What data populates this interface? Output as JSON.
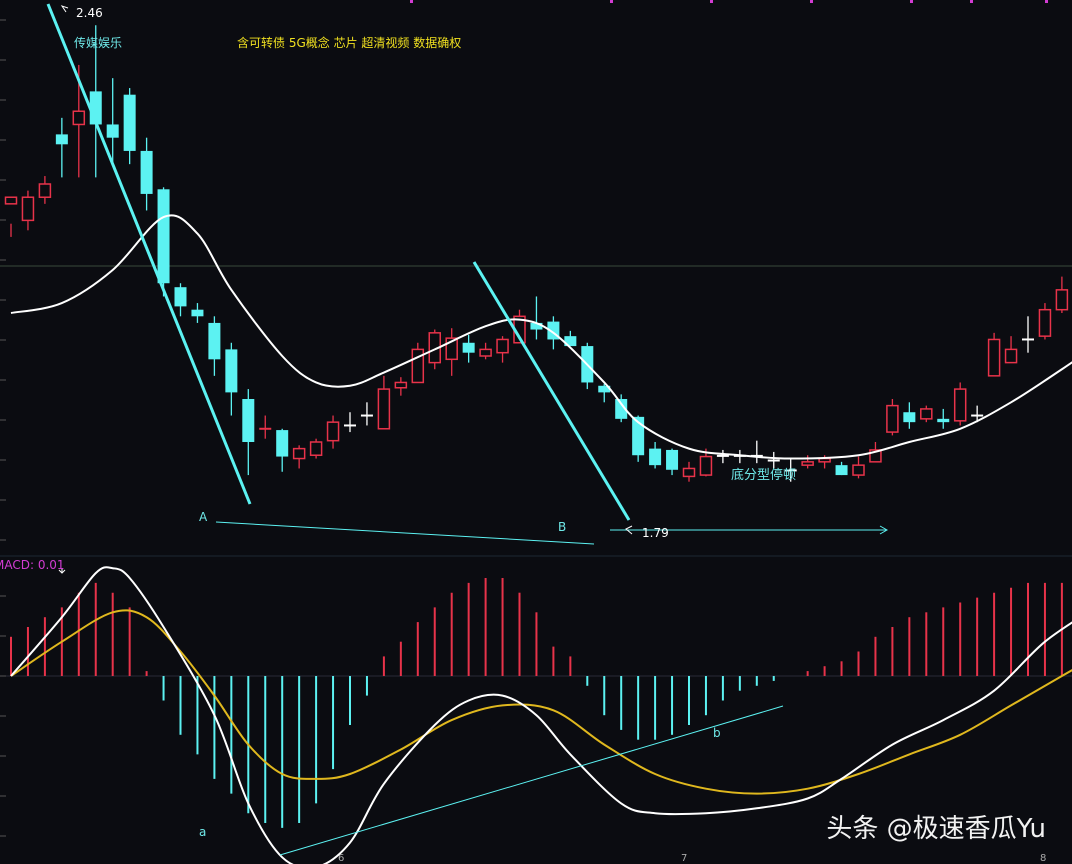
{
  "header": {
    "sector": "传媒娱乐",
    "concepts": "含可转债 5G概念 芯片 超清视频 数据确权"
  },
  "annotations": {
    "high_price": "2.46",
    "low_price": "1.79",
    "point_A": "A",
    "point_B": "B",
    "point_a": "a",
    "point_b": "b",
    "pattern": "底分型停顿"
  },
  "macd_label": "MACD: 0.01",
  "x_ticks": [
    "6",
    "7",
    "8"
  ],
  "watermark": "头条 @极速香瓜Yu",
  "colors": {
    "up": "#e8334a",
    "down": "#5cf2f2",
    "doji": "#ffffff",
    "ma": "#ffffff",
    "dea": "#e0b81e",
    "label_yellow": "#f0e020",
    "label_cyan": "#6fe8e8",
    "macd_label": "#d23cd2"
  },
  "chart_data": {
    "type": "candlestick",
    "price_range": [
      1.7,
      2.48
    ],
    "candles": [
      [
        2.19,
        2.2,
        2.16,
        2.14
      ],
      [
        2.165,
        2.2,
        2.21,
        2.15
      ],
      [
        2.2,
        2.22,
        2.232,
        2.19
      ],
      [
        2.295,
        2.28,
        2.32,
        2.23
      ],
      [
        2.31,
        2.33,
        2.4,
        2.23
      ],
      [
        2.36,
        2.31,
        2.46,
        2.23
      ],
      [
        2.31,
        2.29,
        2.38,
        2.25
      ],
      [
        2.355,
        2.27,
        2.365,
        2.25
      ],
      [
        2.27,
        2.205,
        2.29,
        2.18
      ],
      [
        2.212,
        2.07,
        2.215,
        2.05
      ],
      [
        2.064,
        2.035,
        2.07,
        2.02
      ],
      [
        2.03,
        2.02,
        2.04,
        2.01
      ],
      [
        2.01,
        1.955,
        2.02,
        1.93
      ],
      [
        1.97,
        1.905,
        1.98,
        1.87
      ],
      [
        1.895,
        1.83,
        1.91,
        1.78
      ],
      [
        1.849,
        1.85,
        1.87,
        1.835
      ],
      [
        1.848,
        1.808,
        1.85,
        1.785
      ],
      [
        1.805,
        1.82,
        1.825,
        1.79
      ],
      [
        1.81,
        1.83,
        1.835,
        1.805
      ],
      [
        1.832,
        1.86,
        1.87,
        1.82
      ],
      [
        1.855,
        1.855,
        1.875,
        1.845
      ],
      [
        1.87,
        1.87,
        1.89,
        1.855
      ],
      [
        1.85,
        1.91,
        1.93,
        1.86
      ],
      [
        1.912,
        1.92,
        1.928,
        1.9
      ],
      [
        1.92,
        1.97,
        1.98,
        1.92
      ],
      [
        1.95,
        1.995,
        2.0,
        1.94
      ],
      [
        1.955,
        1.987,
        2.002,
        1.93
      ],
      [
        1.98,
        1.965,
        1.992,
        1.95
      ],
      [
        1.96,
        1.97,
        1.98,
        1.955
      ],
      [
        1.965,
        1.985,
        1.99,
        1.95
      ],
      [
        1.98,
        2.02,
        2.03,
        1.98
      ],
      [
        2.01,
        2.0,
        2.05,
        1.985
      ],
      [
        2.012,
        1.985,
        2.02,
        1.97
      ],
      [
        1.99,
        1.975,
        1.998,
        1.975
      ],
      [
        1.975,
        1.92,
        1.98,
        1.91
      ],
      [
        1.915,
        1.905,
        1.918,
        1.89
      ],
      [
        1.895,
        1.865,
        1.902,
        1.86
      ],
      [
        1.868,
        1.81,
        1.87,
        1.8
      ],
      [
        1.82,
        1.795,
        1.83,
        1.79
      ],
      [
        1.818,
        1.788,
        1.82,
        1.78
      ],
      [
        1.778,
        1.79,
        1.8,
        1.77
      ],
      [
        1.78,
        1.808,
        1.82,
        1.778
      ],
      [
        1.809,
        1.809,
        1.818,
        1.798
      ],
      [
        1.809,
        1.809,
        1.818,
        1.798
      ],
      [
        1.809,
        1.809,
        1.832,
        1.798
      ],
      [
        1.802,
        1.802,
        1.815,
        1.79
      ],
      [
        1.787,
        1.787,
        1.805,
        1.77
      ],
      [
        1.795,
        1.8,
        1.81,
        1.79
      ],
      [
        1.8,
        1.805,
        1.81,
        1.79
      ],
      [
        1.795,
        1.78,
        1.8,
        1.78
      ],
      [
        1.78,
        1.795,
        1.808,
        1.775
      ],
      [
        1.8,
        1.818,
        1.83,
        1.8
      ],
      [
        1.845,
        1.885,
        1.895,
        1.84
      ],
      [
        1.875,
        1.86,
        1.89,
        1.85
      ],
      [
        1.865,
        1.88,
        1.885,
        1.86
      ],
      [
        1.865,
        1.86,
        1.88,
        1.85
      ],
      [
        1.862,
        1.91,
        1.92,
        1.855
      ],
      [
        1.87,
        1.87,
        1.885,
        1.86
      ],
      [
        1.93,
        1.985,
        1.995,
        1.93
      ],
      [
        1.95,
        1.97,
        1.99,
        1.95
      ],
      [
        1.985,
        1.985,
        2.02,
        1.965
      ],
      [
        1.99,
        2.03,
        2.04,
        1.985
      ],
      [
        2.03,
        2.06,
        2.08,
        2.025
      ],
      [
        2.085,
        2.06,
        2.1,
        2.04
      ],
      [
        2.076,
        2.07,
        2.082,
        2.06
      ]
    ],
    "ma": [
      [
        0,
        2.025
      ],
      [
        3,
        2.04
      ],
      [
        6,
        2.09
      ],
      [
        9,
        2.17
      ],
      [
        11,
        2.145
      ],
      [
        13,
        2.06
      ],
      [
        16,
        1.96
      ],
      [
        18,
        1.92
      ],
      [
        20,
        1.915
      ],
      [
        22,
        1.935
      ],
      [
        25,
        1.97
      ],
      [
        28,
        2.005
      ],
      [
        30,
        2.015
      ],
      [
        32,
        1.995
      ],
      [
        35,
        1.92
      ],
      [
        37,
        1.86
      ],
      [
        40,
        1.82
      ],
      [
        43,
        1.81
      ],
      [
        46,
        1.805
      ],
      [
        50,
        1.81
      ],
      [
        53,
        1.83
      ],
      [
        56,
        1.85
      ],
      [
        59,
        1.89
      ],
      [
        62,
        1.94
      ],
      [
        64,
        1.975
      ]
    ],
    "macd_bars": [
      0.08,
      0.1,
      0.12,
      0.14,
      0.17,
      0.19,
      0.17,
      0.14,
      0.01,
      -0.05,
      -0.12,
      -0.16,
      -0.21,
      -0.24,
      -0.28,
      -0.3,
      -0.31,
      -0.3,
      -0.26,
      -0.19,
      -0.1,
      -0.04,
      0.04,
      0.07,
      0.11,
      0.14,
      0.17,
      0.19,
      0.2,
      0.2,
      0.17,
      0.13,
      0.06,
      0.04,
      -0.02,
      -0.08,
      -0.11,
      -0.13,
      -0.13,
      -0.12,
      -0.1,
      -0.08,
      -0.05,
      -0.03,
      -0.02,
      -0.01,
      0.0,
      0.01,
      0.02,
      0.03,
      0.05,
      0.08,
      0.1,
      0.12,
      0.13,
      0.14,
      0.15,
      0.16,
      0.17,
      0.18,
      0.19,
      0.19,
      0.19,
      0.18,
      0.17
    ],
    "dif": [
      [
        0,
        0.0
      ],
      [
        3,
        0.12
      ],
      [
        5,
        0.21
      ],
      [
        6,
        0.22
      ],
      [
        7,
        0.2
      ],
      [
        9,
        0.1
      ],
      [
        12,
        -0.08
      ],
      [
        14,
        -0.26
      ],
      [
        16,
        -0.37
      ],
      [
        18,
        -0.39
      ],
      [
        20,
        -0.34
      ],
      [
        22,
        -0.22
      ],
      [
        25,
        -0.1
      ],
      [
        27,
        -0.05
      ],
      [
        29,
        -0.04
      ],
      [
        31,
        -0.08
      ],
      [
        33,
        -0.16
      ],
      [
        36,
        -0.26
      ],
      [
        38,
        -0.28
      ],
      [
        41,
        -0.28
      ],
      [
        44,
        -0.27
      ],
      [
        47,
        -0.25
      ],
      [
        49,
        -0.21
      ],
      [
        52,
        -0.14
      ],
      [
        55,
        -0.09
      ],
      [
        58,
        -0.03
      ],
      [
        61,
        0.07
      ],
      [
        64,
        0.14
      ]
    ],
    "dea": [
      [
        0,
        0.0
      ],
      [
        3,
        0.07
      ],
      [
        6,
        0.13
      ],
      [
        8,
        0.12
      ],
      [
        10,
        0.05
      ],
      [
        12,
        -0.04
      ],
      [
        14,
        -0.14
      ],
      [
        16,
        -0.2
      ],
      [
        18,
        -0.21
      ],
      [
        20,
        -0.2
      ],
      [
        23,
        -0.15
      ],
      [
        26,
        -0.09
      ],
      [
        29,
        -0.06
      ],
      [
        32,
        -0.07
      ],
      [
        35,
        -0.14
      ],
      [
        38,
        -0.2
      ],
      [
        41,
        -0.23
      ],
      [
        44,
        -0.24
      ],
      [
        47,
        -0.23
      ],
      [
        50,
        -0.2
      ],
      [
        53,
        -0.16
      ],
      [
        56,
        -0.12
      ],
      [
        59,
        -0.06
      ],
      [
        62,
        0.0
      ],
      [
        64,
        0.04
      ]
    ],
    "macd_range": [
      -0.45,
      0.24
    ]
  }
}
